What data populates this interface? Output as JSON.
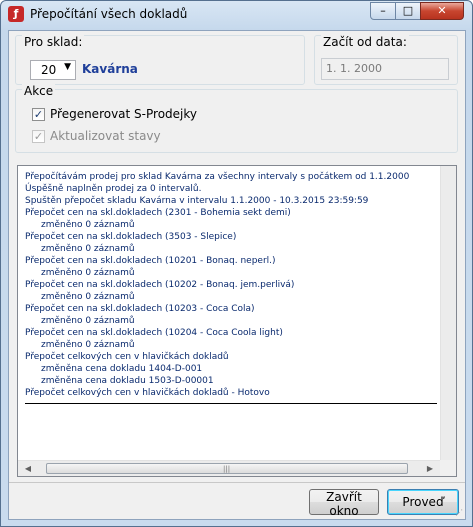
{
  "window": {
    "title": "Přepočítání všech dokladů",
    "app_icon": "fork-knife-icon",
    "controls": {
      "minimize": "–",
      "maximize": "□",
      "close": "✕"
    }
  },
  "store": {
    "label": "Pro sklad:",
    "selected_value": "20",
    "store_name": "Kavárna"
  },
  "start_date": {
    "label": "Začít od data:",
    "value": "1. 1. 2000"
  },
  "actions": {
    "title": "Akce",
    "regenerate": {
      "label": "Přegenerovat S-Prodejky",
      "checked": true,
      "enabled": true
    },
    "update_stock": {
      "label": "Aktualizovat stavy",
      "checked": true,
      "enabled": false
    }
  },
  "log": {
    "lines": [
      {
        "text": "Přepočítávám prodej pro sklad Kavárna za všechny intervaly s počátkem od 1.1.2000",
        "indent": false
      },
      {
        "text": "Úspěšně naplněn prodej za 0 intervalů.",
        "indent": false
      },
      {
        "text": "Spuštěn přepočet skladu Kavárna v intervalu 1.1.2000 - 10.3.2015 23:59:59",
        "indent": false
      },
      {
        "text": "Přepočet cen na skl.dokladech (2301 - Bohemia sekt demi)",
        "indent": false
      },
      {
        "text": "změněno 0 záznamů",
        "indent": true
      },
      {
        "text": "Přepočet cen na skl.dokladech (3503 - Slepice)",
        "indent": false
      },
      {
        "text": "změněno 0 záznamů",
        "indent": true
      },
      {
        "text": "Přepočet cen na skl.dokladech (10201 - Bonaq. neperl.)",
        "indent": false
      },
      {
        "text": "změněno 0 záznamů",
        "indent": true
      },
      {
        "text": "Přepočet cen na skl.dokladech (10202 - Bonaq. jem.perlivá)",
        "indent": false
      },
      {
        "text": "změněno 0 záznamů",
        "indent": true
      },
      {
        "text": "Přepočet cen na skl.dokladech (10203 - Coca Cola)",
        "indent": false
      },
      {
        "text": "změněno 0 záznamů",
        "indent": true
      },
      {
        "text": "Přepočet cen na skl.dokladech (10204 - Coca Coola light)",
        "indent": false
      },
      {
        "text": "změněno 0 záznamů",
        "indent": true
      },
      {
        "text": "Přepočet celkových cen v hlavičkách dokladů",
        "indent": false
      },
      {
        "text": "změněna cena dokladu 1404-D-001",
        "indent": true
      },
      {
        "text": "změněna cena dokladu 1503-D-00001",
        "indent": true
      },
      {
        "text": "Přepočet celkových cen v hlavičkách dokladů - Hotovo",
        "indent": false
      }
    ]
  },
  "buttons": {
    "close": "Zavřít okno",
    "run": "Proveď"
  },
  "colors": {
    "store_name": "#1f3f9a",
    "log_text": "#0a2a6e",
    "title_bar": "#c5d8ec",
    "close_button": "#c8452f"
  }
}
